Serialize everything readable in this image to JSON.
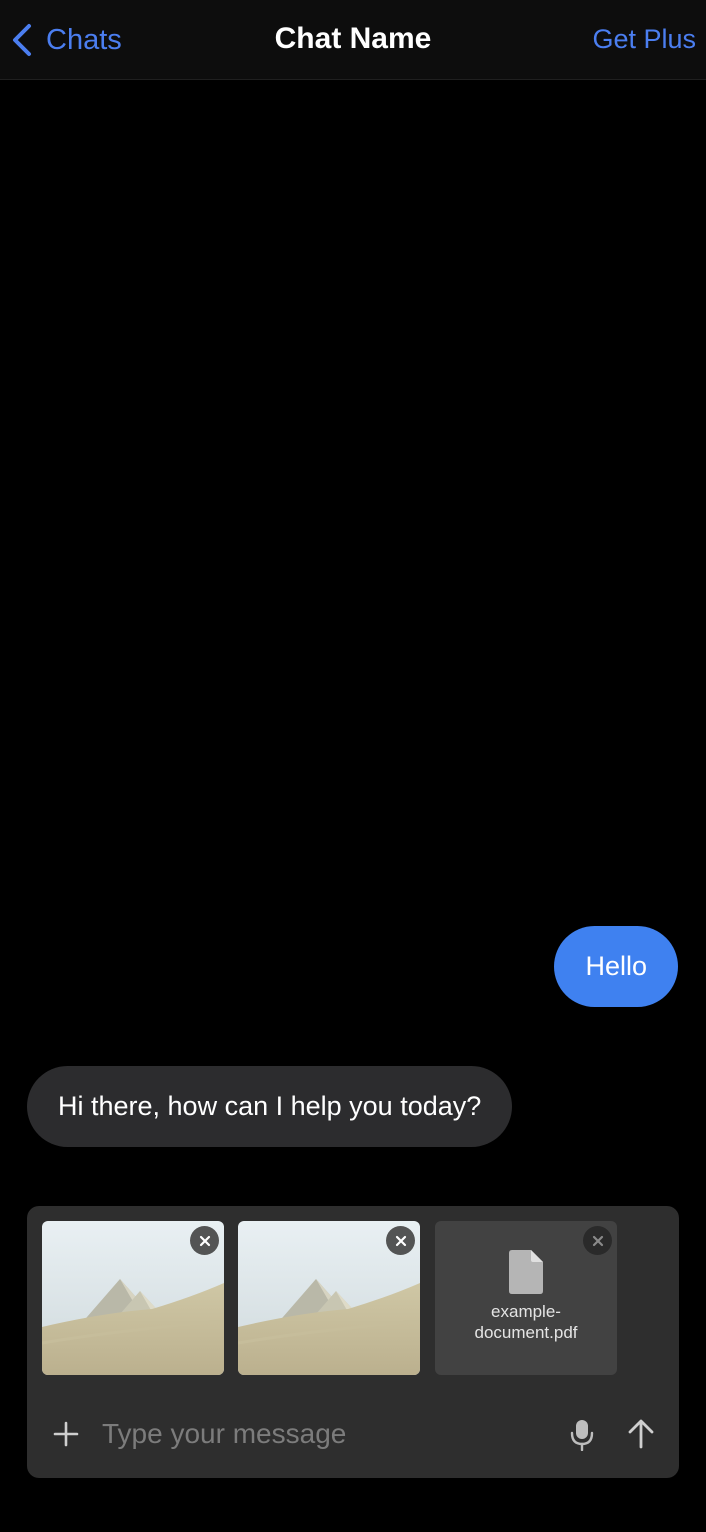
{
  "colors": {
    "accent": "#4b7ef0",
    "user_bubble": "#3f81f0",
    "bot_bubble": "#2c2c2e",
    "background": "#000000",
    "composer": "#2e2e2e"
  },
  "nav": {
    "back_label": "Chats",
    "title": "Chat Name",
    "action_label": "Get Plus",
    "back_icon": "chevron-left-icon"
  },
  "messages": [
    {
      "role": "user",
      "text": "Hello"
    },
    {
      "role": "assistant",
      "text": "Hi there, how can I help you today?"
    }
  ],
  "composer": {
    "attachments": [
      {
        "type": "image",
        "icon": "pyramids-thumbnail"
      },
      {
        "type": "image",
        "icon": "pyramids-thumbnail"
      },
      {
        "type": "file",
        "name": "example-document.pdf",
        "name_display": "example-\ndocument.pdf",
        "icon": "document-icon"
      }
    ],
    "placeholder": "Type your message",
    "value": "",
    "icons": {
      "add": "plus-icon",
      "mic": "mic-icon",
      "send": "arrow-up-icon",
      "remove": "close-icon"
    }
  }
}
